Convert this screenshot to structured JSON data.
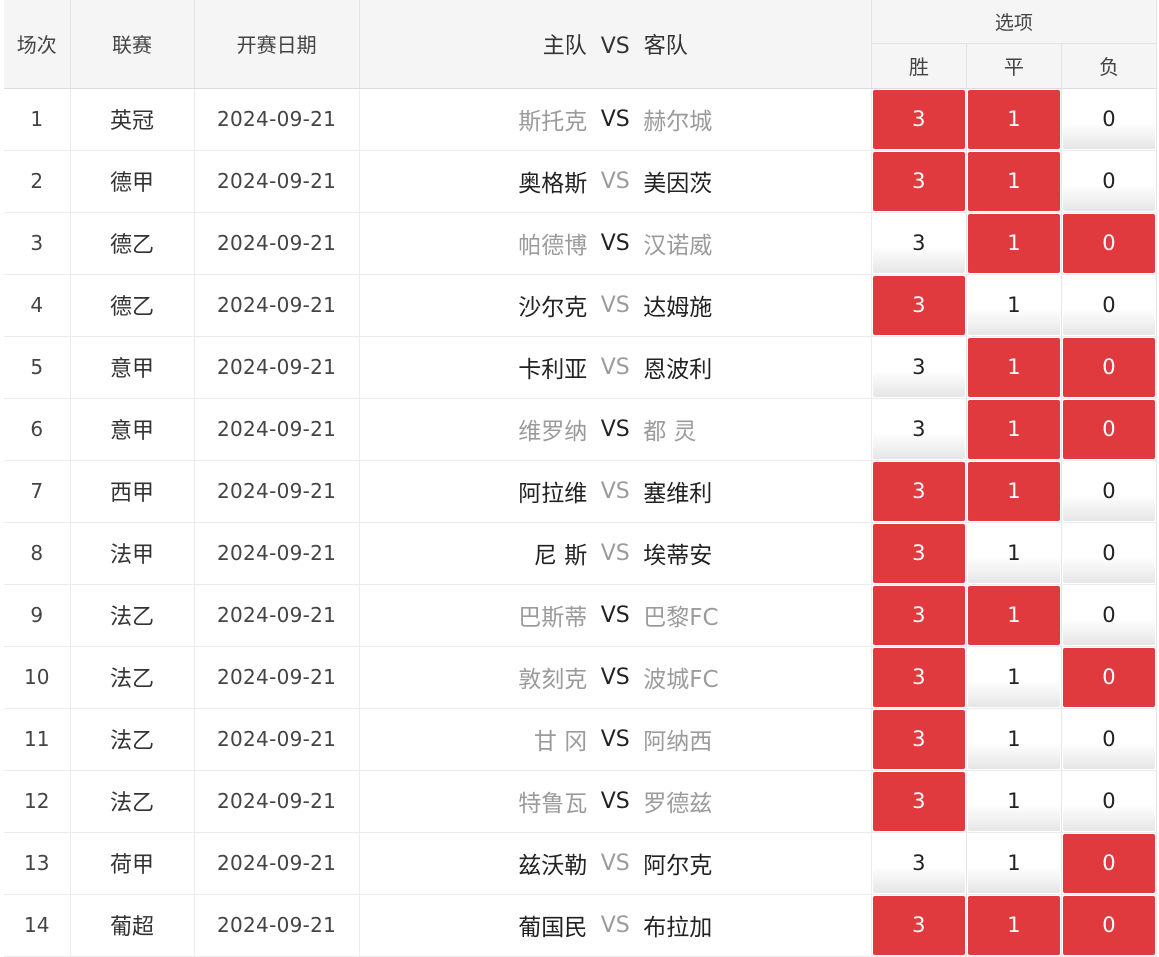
{
  "header": {
    "no": "场次",
    "league": "联赛",
    "date": "开赛日期",
    "home": "主队",
    "vs": "VS",
    "away": "客队",
    "options": "选项",
    "win": "胜",
    "draw": "平",
    "lose": "负"
  },
  "colors": {
    "selected": "#e03a3e",
    "dim_team": "#9b9b9b"
  },
  "rows": [
    {
      "no": "1",
      "league": "英冠",
      "date": "2024-09-21",
      "home": "斯托克",
      "vs": "VS",
      "away": "赫尔城",
      "emph": "vs",
      "opts": [
        {
          "label": "3",
          "selected": true
        },
        {
          "label": "1",
          "selected": true
        },
        {
          "label": "0",
          "selected": false
        }
      ]
    },
    {
      "no": "2",
      "league": "德甲",
      "date": "2024-09-21",
      "home": "奥格斯",
      "vs": "VS",
      "away": "美因茨",
      "emph": "teams",
      "opts": [
        {
          "label": "3",
          "selected": true
        },
        {
          "label": "1",
          "selected": true
        },
        {
          "label": "0",
          "selected": false
        }
      ]
    },
    {
      "no": "3",
      "league": "德乙",
      "date": "2024-09-21",
      "home": "帕德博",
      "vs": "VS",
      "away": "汉诺威",
      "emph": "vs",
      "opts": [
        {
          "label": "3",
          "selected": false
        },
        {
          "label": "1",
          "selected": true
        },
        {
          "label": "0",
          "selected": true
        }
      ]
    },
    {
      "no": "4",
      "league": "德乙",
      "date": "2024-09-21",
      "home": "沙尔克",
      "vs": "VS",
      "away": "达姆施",
      "emph": "teams",
      "opts": [
        {
          "label": "3",
          "selected": true
        },
        {
          "label": "1",
          "selected": false
        },
        {
          "label": "0",
          "selected": false
        }
      ]
    },
    {
      "no": "5",
      "league": "意甲",
      "date": "2024-09-21",
      "home": "卡利亚",
      "vs": "VS",
      "away": "恩波利",
      "emph": "teams",
      "opts": [
        {
          "label": "3",
          "selected": false
        },
        {
          "label": "1",
          "selected": true
        },
        {
          "label": "0",
          "selected": true
        }
      ]
    },
    {
      "no": "6",
      "league": "意甲",
      "date": "2024-09-21",
      "home": "维罗纳",
      "vs": "VS",
      "away": "都 灵",
      "emph": "vs",
      "opts": [
        {
          "label": "3",
          "selected": false
        },
        {
          "label": "1",
          "selected": true
        },
        {
          "label": "0",
          "selected": true
        }
      ]
    },
    {
      "no": "7",
      "league": "西甲",
      "date": "2024-09-21",
      "home": "阿拉维",
      "vs": "VS",
      "away": "塞维利",
      "emph": "teams",
      "opts": [
        {
          "label": "3",
          "selected": true
        },
        {
          "label": "1",
          "selected": true
        },
        {
          "label": "0",
          "selected": false
        }
      ]
    },
    {
      "no": "8",
      "league": "法甲",
      "date": "2024-09-21",
      "home": "尼 斯",
      "vs": "VS",
      "away": "埃蒂安",
      "emph": "teams",
      "opts": [
        {
          "label": "3",
          "selected": true
        },
        {
          "label": "1",
          "selected": false
        },
        {
          "label": "0",
          "selected": false
        }
      ]
    },
    {
      "no": "9",
      "league": "法乙",
      "date": "2024-09-21",
      "home": "巴斯蒂",
      "vs": "VS",
      "away": "巴黎FC",
      "emph": "vs",
      "opts": [
        {
          "label": "3",
          "selected": true
        },
        {
          "label": "1",
          "selected": true
        },
        {
          "label": "0",
          "selected": false
        }
      ]
    },
    {
      "no": "10",
      "league": "法乙",
      "date": "2024-09-21",
      "home": "敦刻克",
      "vs": "VS",
      "away": "波城FC",
      "emph": "vs",
      "opts": [
        {
          "label": "3",
          "selected": true
        },
        {
          "label": "1",
          "selected": false
        },
        {
          "label": "0",
          "selected": true
        }
      ]
    },
    {
      "no": "11",
      "league": "法乙",
      "date": "2024-09-21",
      "home": "甘 冈",
      "vs": "VS",
      "away": "阿纳西",
      "emph": "vs",
      "opts": [
        {
          "label": "3",
          "selected": true
        },
        {
          "label": "1",
          "selected": false
        },
        {
          "label": "0",
          "selected": false
        }
      ]
    },
    {
      "no": "12",
      "league": "法乙",
      "date": "2024-09-21",
      "home": "特鲁瓦",
      "vs": "VS",
      "away": "罗德兹",
      "emph": "vs",
      "opts": [
        {
          "label": "3",
          "selected": true
        },
        {
          "label": "1",
          "selected": false
        },
        {
          "label": "0",
          "selected": false
        }
      ]
    },
    {
      "no": "13",
      "league": "荷甲",
      "date": "2024-09-21",
      "home": "兹沃勒",
      "vs": "VS",
      "away": "阿尔克",
      "emph": "teams",
      "opts": [
        {
          "label": "3",
          "selected": false
        },
        {
          "label": "1",
          "selected": false
        },
        {
          "label": "0",
          "selected": true
        }
      ]
    },
    {
      "no": "14",
      "league": "葡超",
      "date": "2024-09-21",
      "home": "葡国民",
      "vs": "VS",
      "away": "布拉加",
      "emph": "teams",
      "opts": [
        {
          "label": "3",
          "selected": true
        },
        {
          "label": "1",
          "selected": true
        },
        {
          "label": "0",
          "selected": true
        }
      ]
    }
  ]
}
